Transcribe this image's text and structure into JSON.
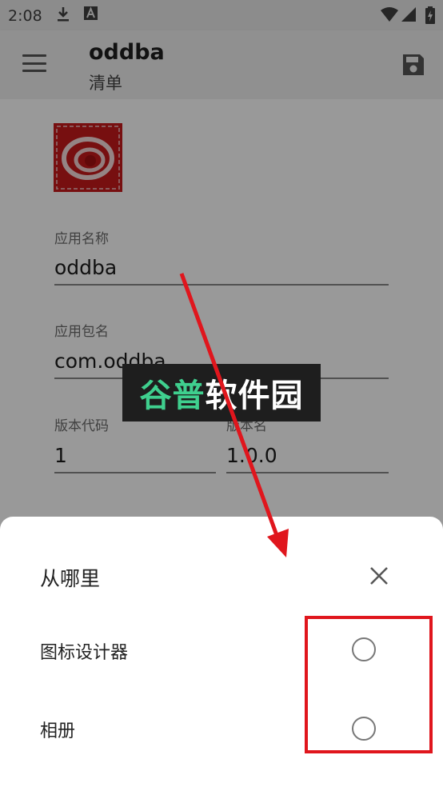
{
  "status_bar": {
    "time": "2:08",
    "icons": [
      "download-icon",
      "a-icon",
      "wifi-icon",
      "signal-icon",
      "battery-icon"
    ]
  },
  "app_bar": {
    "title": "oddba",
    "subtitle": "清单",
    "icons": [
      "menu-icon",
      "save-icon"
    ]
  },
  "form": {
    "app_name": {
      "label": "应用名称",
      "value": "oddba"
    },
    "package_name": {
      "label": "应用包名",
      "value": "com.oddba"
    },
    "version_code": {
      "label": "版本代码",
      "value": "1"
    },
    "version_name": {
      "label": "版本名",
      "value": "1.0.0"
    }
  },
  "watermark": {
    "part1": "谷普",
    "part2": "软件园"
  },
  "sheet": {
    "title": "从哪里",
    "options": [
      {
        "label": "图标设计器",
        "selected": false
      },
      {
        "label": "相册",
        "selected": false
      }
    ]
  },
  "colors": {
    "annotation_red": "#e0161d",
    "watermark_green": "#3fcf8e"
  }
}
